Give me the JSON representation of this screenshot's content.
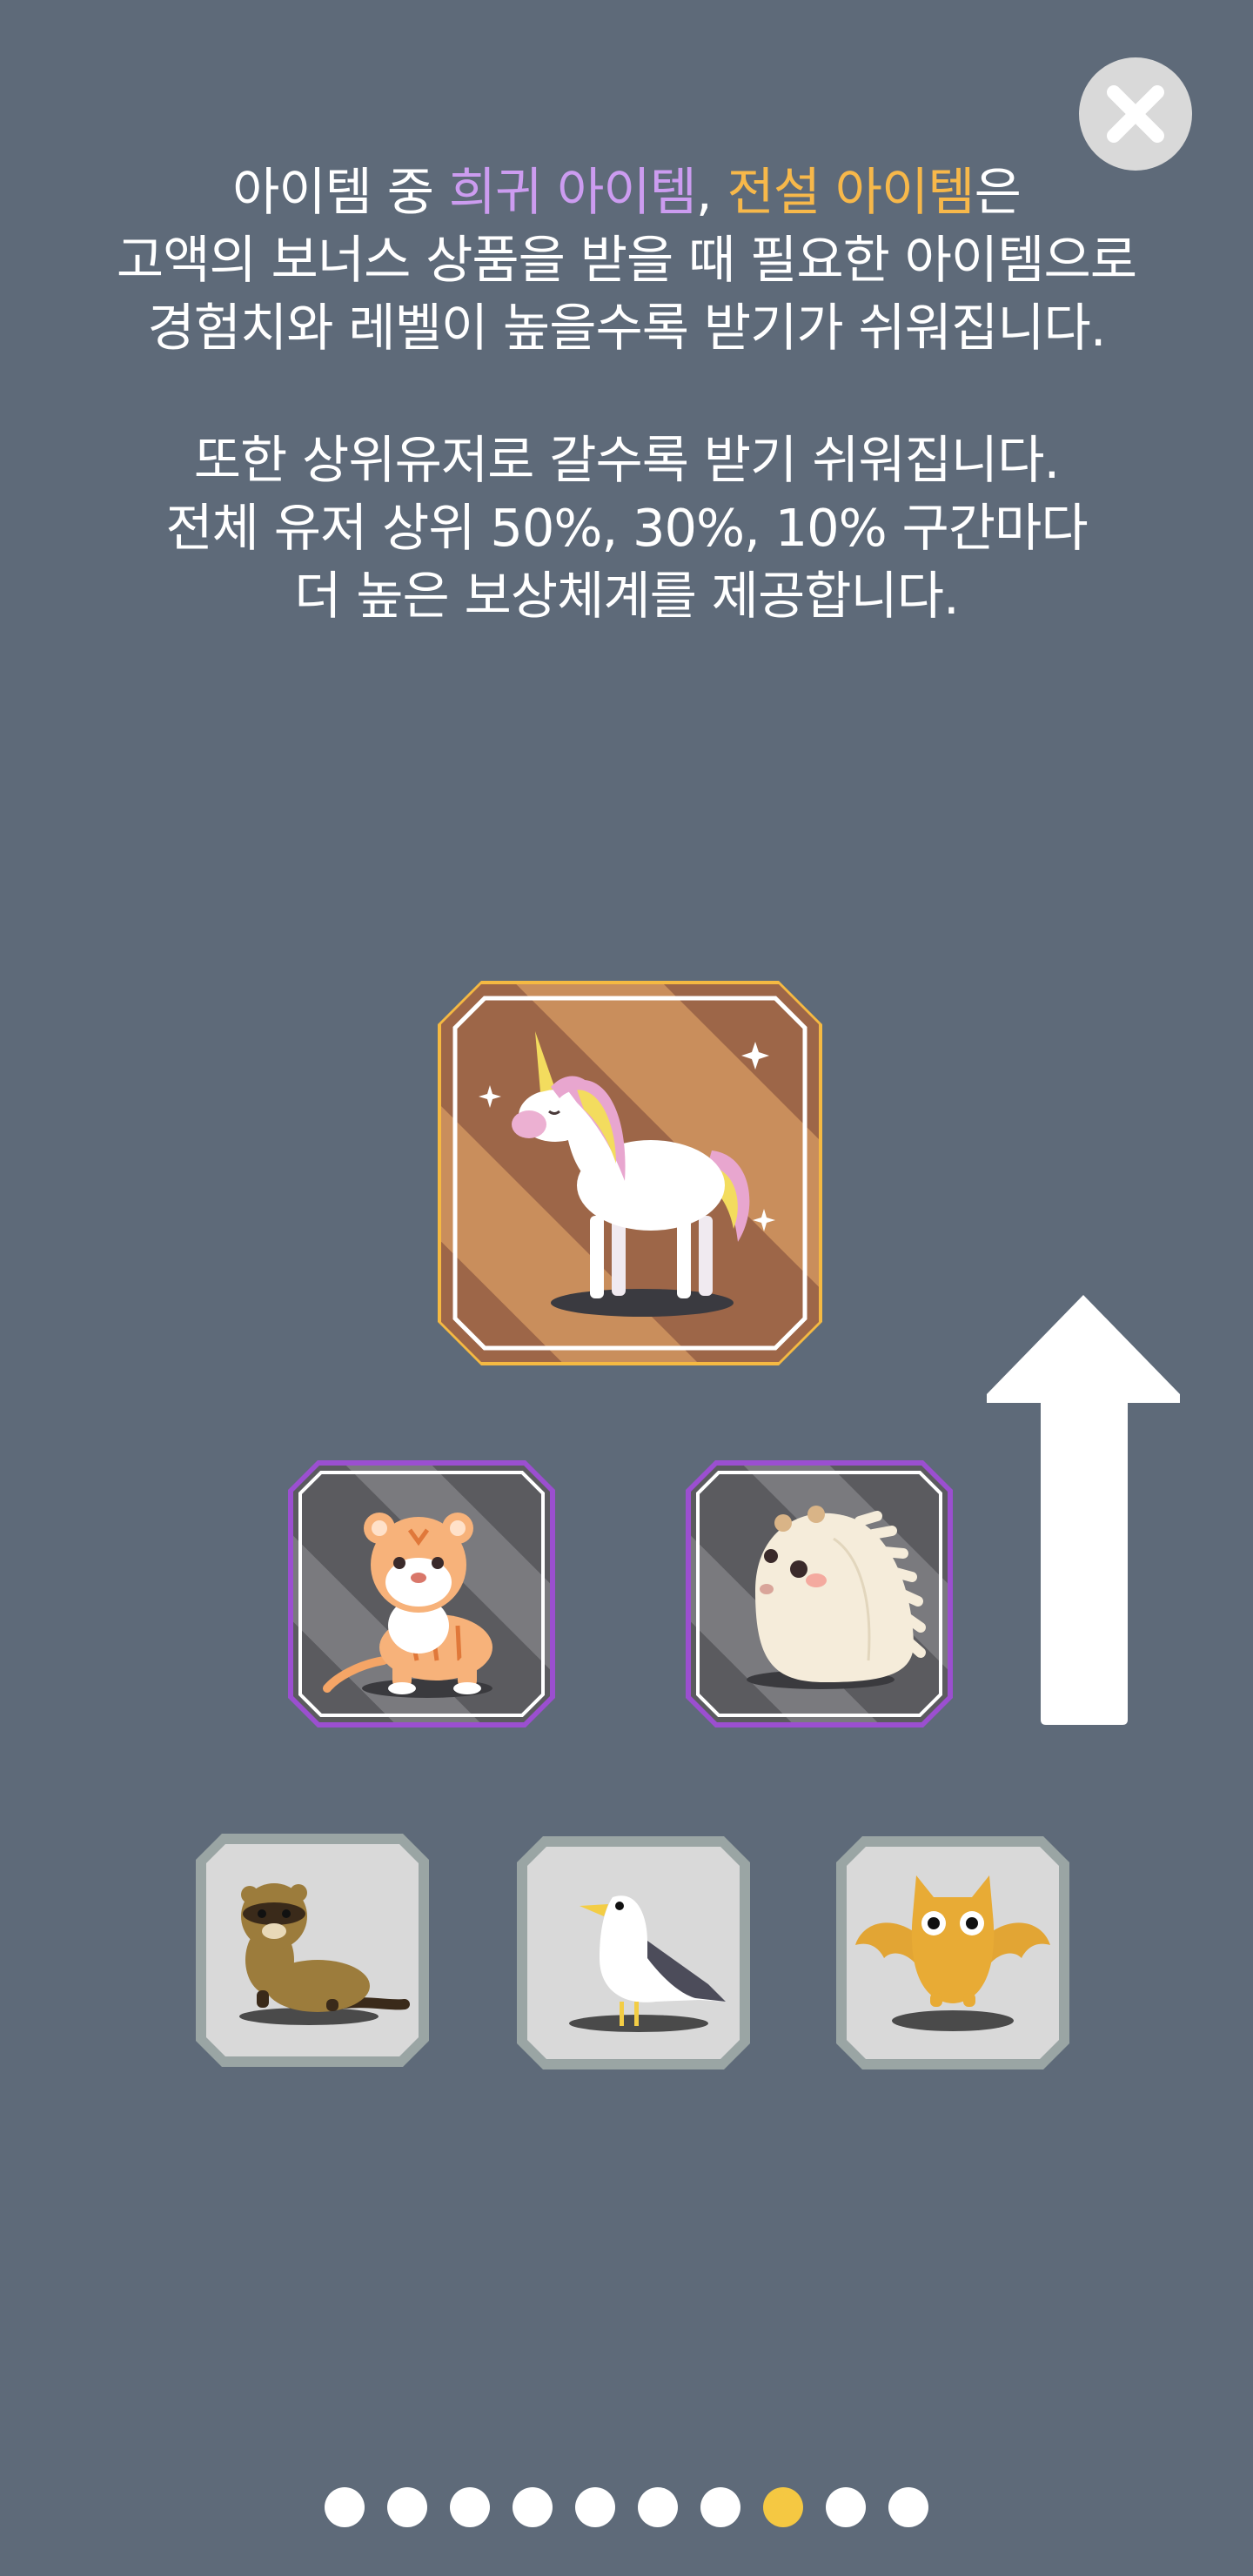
{
  "intro": {
    "line1": {
      "prefix": "아이템 중 ",
      "rare": "희귀 아이템",
      "comma": ", ",
      "legend": "전설 아이템",
      "suffix": "은"
    },
    "line2": "고액의 보너스 상품을 받을 때 필요한 아이템으로",
    "line3": "경험치와 레벨이 높을수록 받기가 쉬워집니다.",
    "line4": "또한 상위유저로 갈수록 받기 쉬워집니다.",
    "line5": "전체 유저 상위 50%, 30%, 10% 구간마다",
    "line6": "더 높은 보상체계를 제공합니다."
  },
  "items": {
    "legend": {
      "icon": "unicorn-icon",
      "frame_color": "#f5b942"
    },
    "rare": [
      {
        "icon": "tiger-icon",
        "frame_color": "#9b4fd0"
      },
      {
        "icon": "hedgehog-icon",
        "frame_color": "#9b4fd0"
      }
    ],
    "common": [
      {
        "icon": "ferret-icon",
        "frame_color": "#9aa5a4"
      },
      {
        "icon": "seagull-icon",
        "frame_color": "#9aa5a4"
      },
      {
        "icon": "yellow-bat-icon",
        "frame_color": "#9aa5a4"
      }
    ]
  },
  "arrow": {
    "icon": "up-arrow-icon"
  },
  "close": {
    "icon": "close-icon"
  },
  "pagination": {
    "total": 10,
    "current": 8,
    "active_color": "#f5c842"
  },
  "colors": {
    "background": "#5e6a79",
    "rare_text": "#cc9cf0",
    "legend_text": "#f7b84a"
  }
}
